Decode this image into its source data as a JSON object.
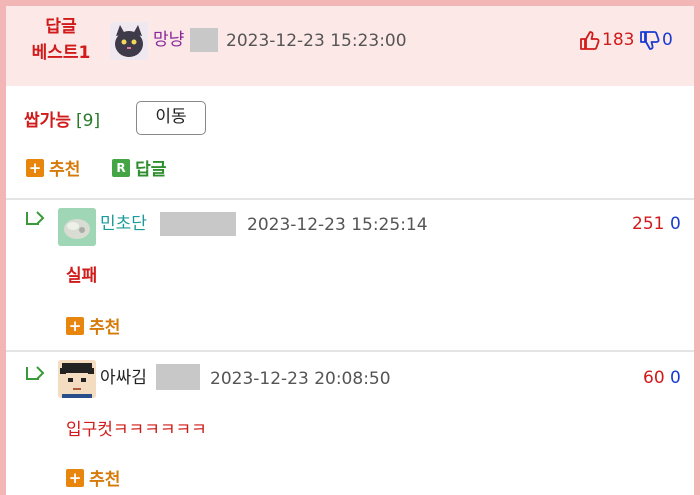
{
  "best": {
    "label_line1": "답글",
    "label_line2": "베스트1",
    "nickname": "망냥",
    "datetime": "2023-12-23 15:23:00",
    "up_count": "183",
    "down_count": "0"
  },
  "post": {
    "title": "쌉가능",
    "count": "[9]",
    "move_button": "이동",
    "recommend_label": "추천",
    "reply_label": "답글"
  },
  "replies": [
    {
      "nickname": "민초단",
      "datetime": "2023-12-23 15:25:14",
      "up_count": "251",
      "down_count": "0",
      "text": "실패",
      "recommend_label": "추천"
    },
    {
      "nickname": "아싸김",
      "datetime": "2023-12-23 20:08:50",
      "up_count": "60",
      "down_count": "0",
      "text": "입구컷ㅋㅋㅋㅋㅋㅋ",
      "recommend_label": "추천"
    }
  ],
  "colors": {
    "accent_red": "#d11a1a",
    "accent_blue": "#1a3bd1",
    "frame_pink": "#f3b6b6",
    "header_bg": "#fde8e8"
  }
}
